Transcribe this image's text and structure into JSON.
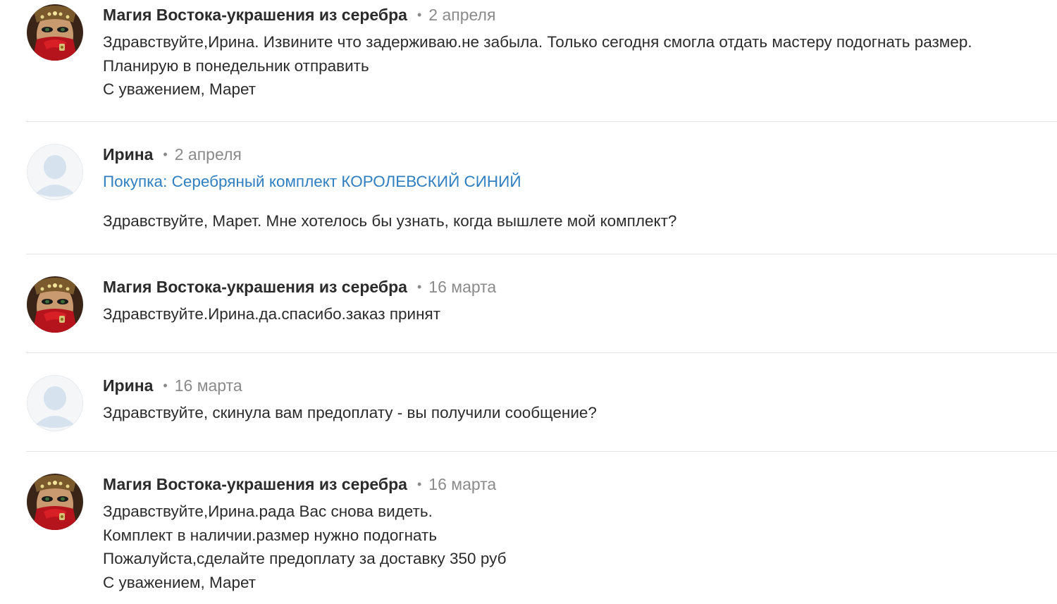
{
  "messages": [
    {
      "author": "Магия Востока-украшения из серебра",
      "separator": "•",
      "date": "2 апреля",
      "avatar": "seller-avatar",
      "lines": [
        "Здравствуйте,Ирина. Извините что задерживаю.не забыла. Только сегодня смогла отдать мастеру подогнать размер.",
        "Планирую в понедельник отправить",
        "С уважением, Марет"
      ]
    },
    {
      "author": "Ирина",
      "separator": "•",
      "date": "2 апреля",
      "avatar": "default-user-avatar",
      "purchase": "Покупка: Серебряный комплект КОРОЛЕВСКИЙ СИНИЙ",
      "lines": [
        "Здравствуйте, Марет. Мне хотелось бы узнать, когда вышлете мой комплект?"
      ]
    },
    {
      "author": "Магия Востока-украшения из серебра",
      "separator": "•",
      "date": "16 марта",
      "avatar": "seller-avatar",
      "lines": [
        "Здравствуйте.Ирина.да.спасибо.заказ принят"
      ]
    },
    {
      "author": "Ирина",
      "separator": "•",
      "date": "16 марта",
      "avatar": "default-user-avatar",
      "lines": [
        "Здравствуйте, скинула вам предоплату - вы получили сообщение?"
      ]
    },
    {
      "author": "Магия Востока-украшения из серебра",
      "separator": "•",
      "date": "16 марта",
      "avatar": "seller-avatar",
      "lines": [
        "Здравствуйте,Ирина.рада Вас снова видеть.",
        "Комплект в наличии.размер нужно подогнать",
        "Пожалуйста,сделайте предоплату за доставку 350 руб",
        "С уважением, Марет"
      ]
    }
  ],
  "colors": {
    "text": "#2b2b2b",
    "muted": "#8a8a8a",
    "link": "#2f7fc1",
    "divider": "#e3e3e3",
    "default_avatar_bg": "#f4f6f8",
    "default_avatar_figure": "#d6e2ee"
  }
}
